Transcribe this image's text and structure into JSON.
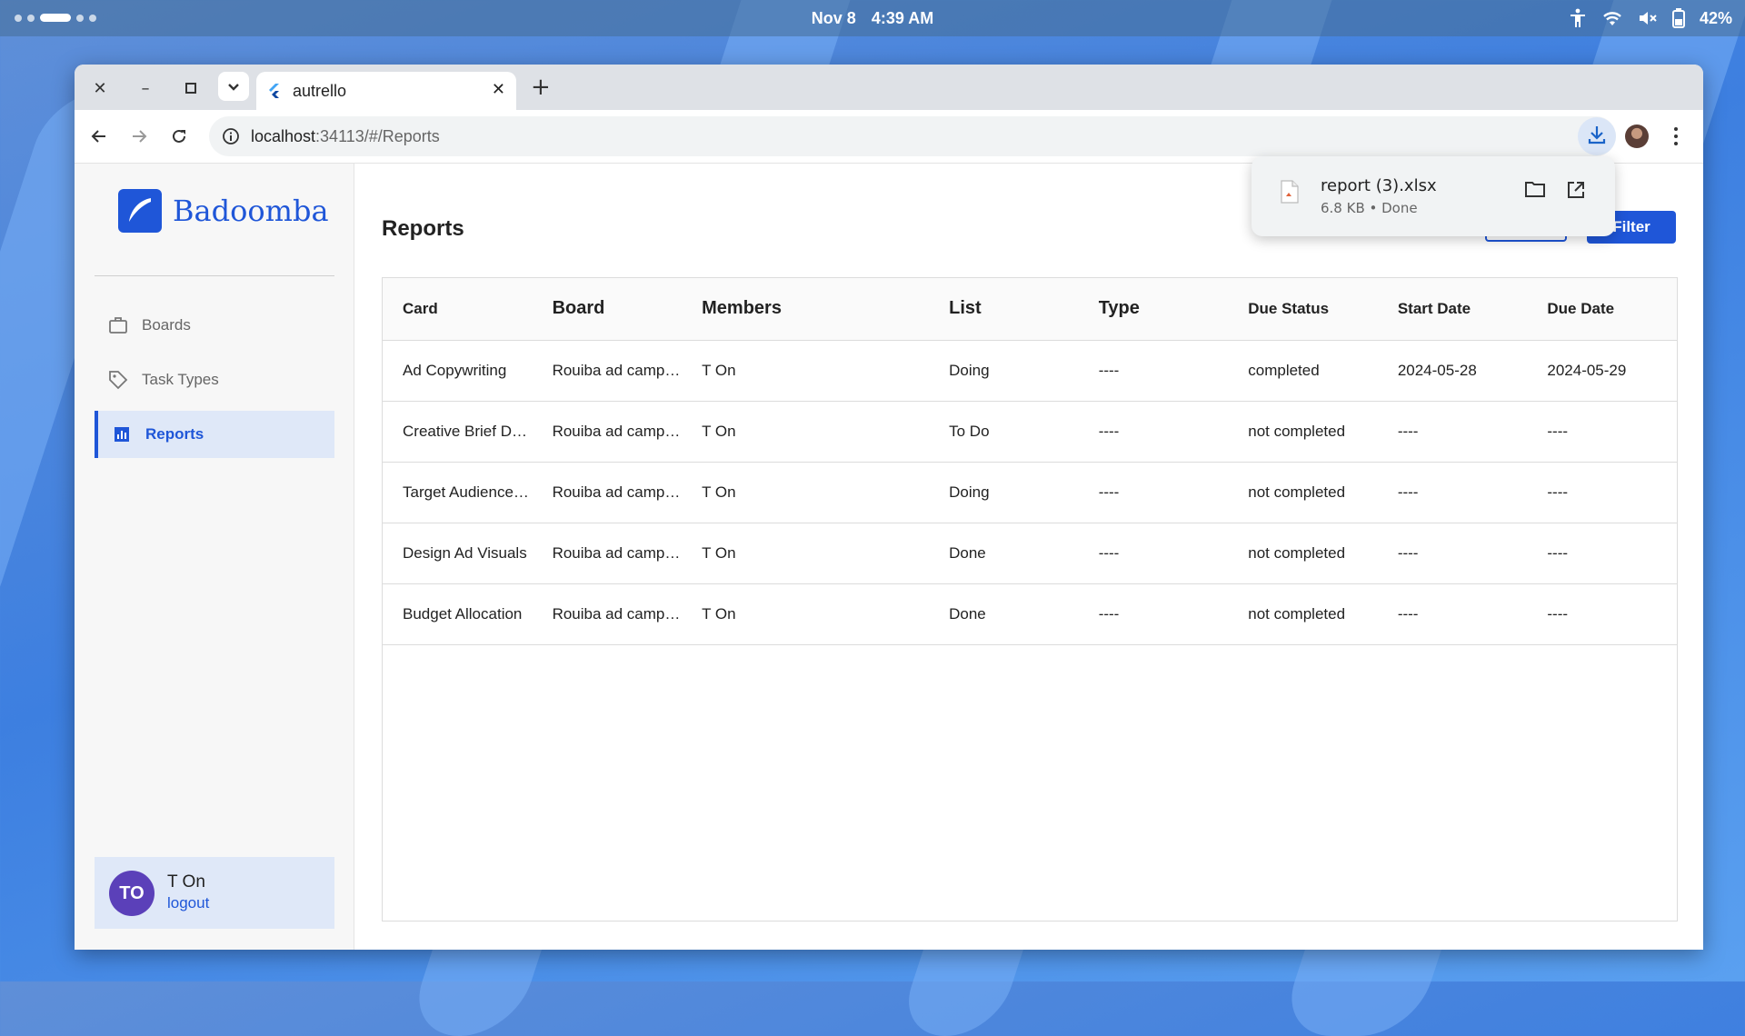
{
  "system_bar": {
    "date": "Nov 8",
    "time": "4:39 AM",
    "battery": "42%",
    "icons": [
      "accessibility-icon",
      "wifi-icon",
      "volume-muted-icon",
      "battery-icon"
    ]
  },
  "browser": {
    "tab_title": "autrello",
    "url_host": "localhost",
    "url_path": ":34113/#/Reports",
    "download": {
      "file_name": "report (3).xlsx",
      "file_meta": "6.8 KB • Done"
    }
  },
  "app": {
    "brand": "Badoomba",
    "brand_color": "#1f56d8",
    "nav": [
      {
        "label": "Boards",
        "icon": "briefcase-icon",
        "active": false
      },
      {
        "label": "Task Types",
        "icon": "tag-icon",
        "active": false
      },
      {
        "label": "Reports",
        "icon": "bar-chart-icon",
        "active": true
      }
    ],
    "user": {
      "initials": "TO",
      "name": "T On",
      "logout_label": "logout",
      "avatar_color": "#5b40b9"
    }
  },
  "reports": {
    "title": "Reports",
    "filter_label": "Filter",
    "columns": [
      "Card",
      "Board",
      "Members",
      "List",
      "Type",
      "Due Status",
      "Start Date",
      "Due Date"
    ],
    "rows": [
      [
        "Ad Copywriting",
        "Rouiba ad camp…",
        "T On",
        "Doing",
        "----",
        "completed",
        "2024-05-28",
        "2024-05-29"
      ],
      [
        "Creative Brief De…",
        "Rouiba ad camp…",
        "T On",
        "To Do",
        "----",
        "not completed",
        "----",
        "----"
      ],
      [
        "Target Audience …",
        "Rouiba ad camp…",
        "T On",
        "Doing",
        "----",
        "not completed",
        "----",
        "----"
      ],
      [
        "Design Ad Visuals",
        "Rouiba ad camp…",
        "T On",
        "Done",
        "----",
        "not completed",
        "----",
        "----"
      ],
      [
        "Budget Allocation",
        "Rouiba ad camp…",
        "T On",
        "Done",
        "----",
        "not completed",
        "----",
        "----"
      ]
    ]
  }
}
